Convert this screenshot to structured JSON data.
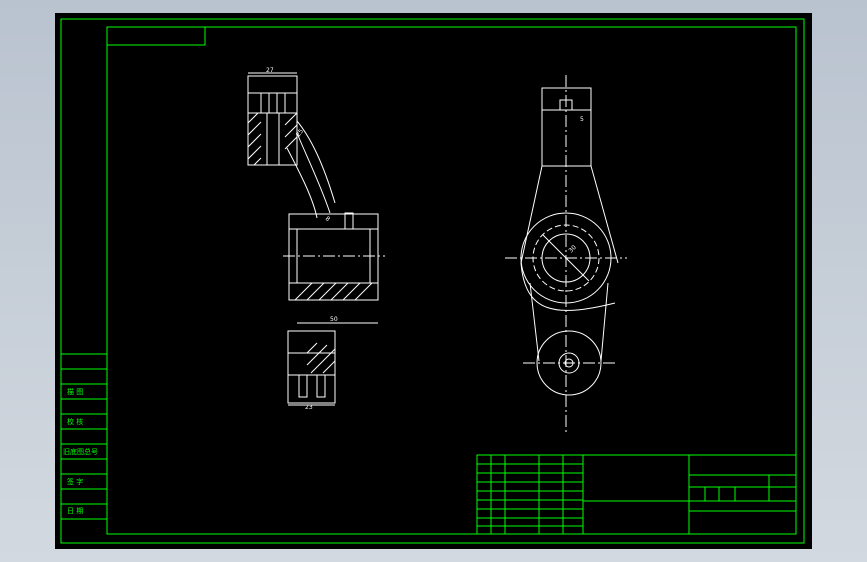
{
  "drawing": {
    "dimensions": {
      "top_width": "27",
      "arm_angle": "25",
      "slot_diameter": "8",
      "pin_dim": "5",
      "length_50": "50",
      "bottom_width": "23",
      "bore_diameter": "30"
    },
    "title_block_side": {
      "draw_label": "描 图",
      "check_label": "校 核",
      "old_drawing_no_label": "旧底图总号",
      "sign_label": "签 字",
      "date_label": "日 期"
    },
    "colors": {
      "frame": "#00ff00",
      "geometry": "#ffffff",
      "background": "#000000"
    }
  }
}
